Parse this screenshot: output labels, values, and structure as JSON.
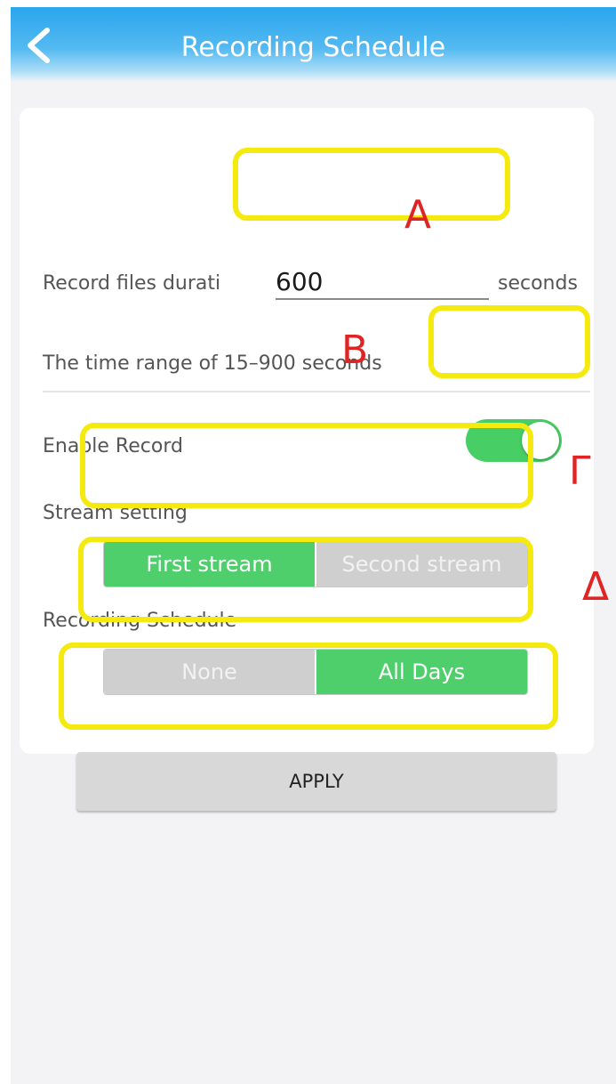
{
  "header": {
    "title": "Recording Schedule",
    "back_icon": "chevron-left-icon"
  },
  "duration": {
    "label_prefix": "Record files durati",
    "label_suffix": "seconds",
    "value": "600",
    "hint": "The time range of 15–900 seconds"
  },
  "enable_record": {
    "label": "Enable Record",
    "enabled": true
  },
  "stream_setting": {
    "label": "Stream setting",
    "options": [
      "First stream",
      "Second stream"
    ],
    "selected": "First stream"
  },
  "recording_schedule": {
    "label": "Recording Schedule",
    "options": [
      "None",
      "All Days"
    ],
    "selected": "All Days"
  },
  "apply_button": {
    "label": "APPLY"
  },
  "annotations": {
    "a": "A",
    "b": "B",
    "g": "Γ",
    "d": "Δ"
  },
  "colors": {
    "header": "#2aa6ee",
    "active_green": "#4fcf6b",
    "inactive_gray": "#cfcfcf",
    "highlight_yellow": "#f4ea10",
    "annotation_red": "#e02424"
  }
}
